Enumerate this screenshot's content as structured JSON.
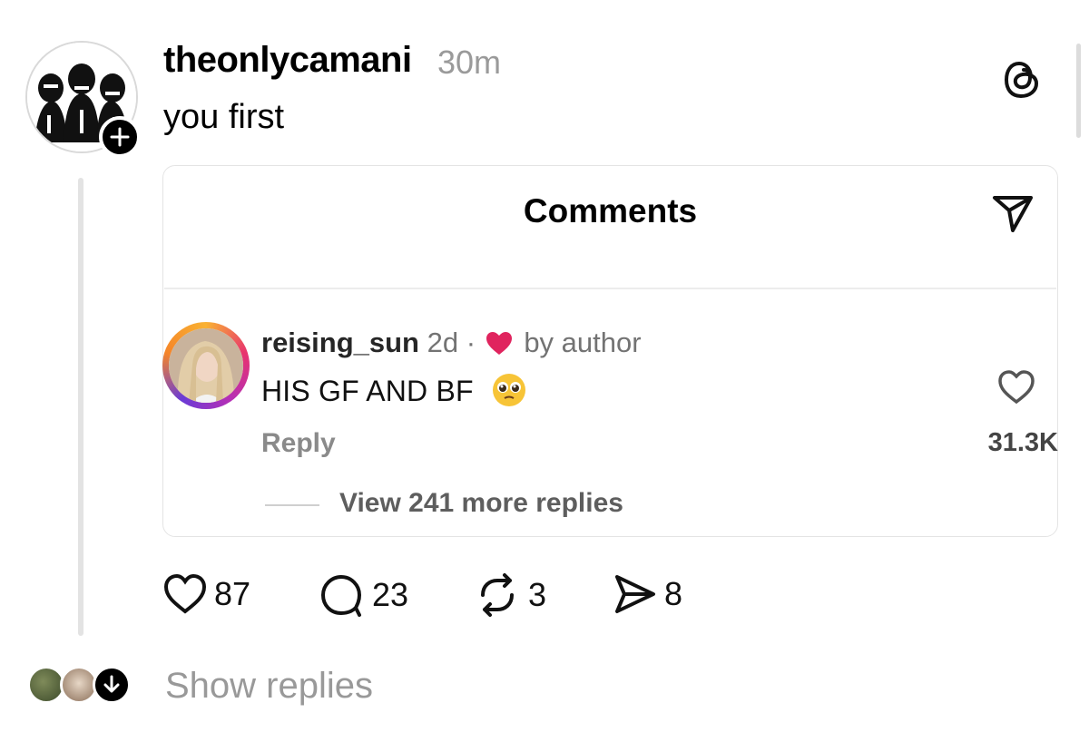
{
  "post": {
    "username": "theonlycamani",
    "timestamp": "30m",
    "text": "you first"
  },
  "embedded_comment": {
    "header": "Comments",
    "username": "reising_sun",
    "age": "2d",
    "separator": "·",
    "liked_by": "by author",
    "text": "HIS GF AND BF",
    "reply_label": "Reply",
    "like_count": "31.3K",
    "view_more": "View 241 more replies"
  },
  "actions": {
    "likes": "87",
    "comments": "23",
    "reposts": "3",
    "shares": "8"
  },
  "footer": {
    "show_replies": "Show replies"
  },
  "colors": {
    "text": "#000000",
    "muted": "#9a9a9a",
    "heart_red": "#e0245e",
    "thread_line": "#e3e3e3"
  },
  "icons": [
    "threads-logo-icon",
    "plus-icon",
    "send-icon",
    "heart-icon",
    "comment-icon",
    "repost-icon",
    "share-icon",
    "down-arrow-icon"
  ]
}
